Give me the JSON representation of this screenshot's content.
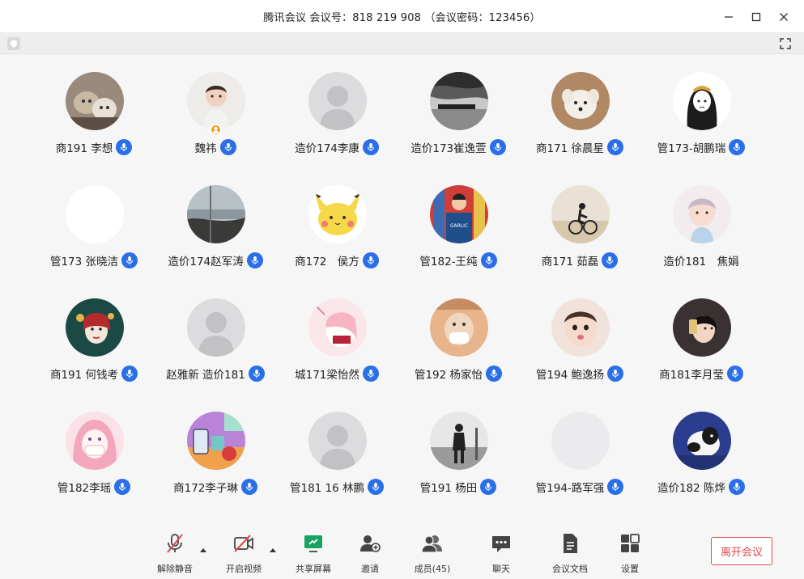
{
  "window": {
    "title": "腾讯会议 会议号：818 219 908 （会议密码：123456）"
  },
  "participants": [
    {
      "name": "商191 李想",
      "avatar": "cats-photo",
      "mic": true
    },
    {
      "name": "魏祎",
      "avatar": "baby-photo",
      "mic": true,
      "host": true
    },
    {
      "name": "造价174李康",
      "avatar": "default-person",
      "mic": true
    },
    {
      "name": "造价173崔逸萱",
      "avatar": "ship-bw-photo",
      "mic": true
    },
    {
      "name": "商171 徐晨星",
      "avatar": "dog-photo",
      "mic": true
    },
    {
      "name": "管173-胡鹏瑞",
      "avatar": "cartoon-girl",
      "mic": true
    },
    {
      "name": "管173 张晓洁",
      "avatar": "blank-white",
      "mic": true
    },
    {
      "name": "造价174赵军涛",
      "avatar": "seaside-photo",
      "mic": true
    },
    {
      "name": "商172　侯方",
      "avatar": "pikachu-cartoon",
      "mic": true
    },
    {
      "name": "管182-王纯",
      "avatar": "store-photo",
      "mic": true
    },
    {
      "name": "商171 茹磊",
      "avatar": "cyclist-photo",
      "mic": true
    },
    {
      "name": "造价181　焦娟",
      "avatar": "child-photo",
      "mic": false
    },
    {
      "name": "商191 何钱考",
      "avatar": "opera-art",
      "mic": true
    },
    {
      "name": "赵雅新 造价181",
      "avatar": "default-person",
      "mic": true
    },
    {
      "name": "城171梁怡然",
      "avatar": "pink-anime",
      "mic": true
    },
    {
      "name": "管192 杨家怡",
      "avatar": "mask-photo",
      "mic": true
    },
    {
      "name": "管194 鲍逸扬",
      "avatar": "baby-face-photo",
      "mic": true
    },
    {
      "name": "商181李月莹",
      "avatar": "selfie-photo",
      "mic": true
    },
    {
      "name": "管182李瑶",
      "avatar": "pink-hair-anime",
      "mic": true
    },
    {
      "name": "商172李子琳",
      "avatar": "cartoon-drink",
      "mic": true
    },
    {
      "name": "管181 16 林鹏",
      "avatar": "default-person",
      "mic": true
    },
    {
      "name": "管191 杨田",
      "avatar": "man-bw-photo",
      "mic": true
    },
    {
      "name": "管194-路军强",
      "avatar": "blank-gray",
      "mic": true
    },
    {
      "name": "造价182 陈烨",
      "avatar": "dog-hands-photo",
      "mic": true
    }
  ],
  "toolbar": {
    "unmute": "解除静音",
    "start_video": "开启视频",
    "share_screen": "共享屏幕",
    "invite": "邀请",
    "members": "成员(45)",
    "chat": "聊天",
    "docs": "会议文档",
    "settings": "设置",
    "leave": "离开会议"
  },
  "colors": {
    "mic_blue": "#2a6fe8",
    "leave_red": "#e0474f",
    "share_green": "#1aa260",
    "mute_red": "#e0474f"
  }
}
